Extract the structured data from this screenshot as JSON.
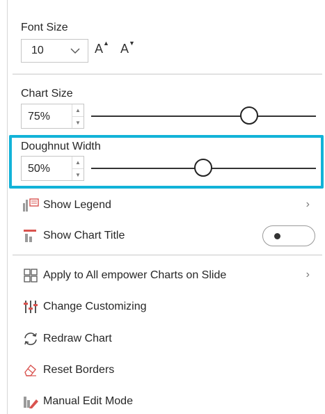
{
  "font_size": {
    "label": "Font Size",
    "value": "10",
    "increase_label": "A",
    "decrease_label": "A"
  },
  "chart_size": {
    "label": "Chart Size",
    "value": "75%",
    "slider_fraction": 0.74
  },
  "doughnut_width": {
    "label": "Doughnut Width",
    "value": "50%",
    "slider_fraction": 0.5
  },
  "menu": {
    "show_legend": "Show Legend",
    "show_chart_title": "Show Chart Title",
    "apply_all": "Apply to All empower Charts on Slide",
    "change_customizing": "Change Customizing",
    "redraw_chart": "Redraw Chart",
    "reset_borders": "Reset Borders",
    "manual_edit_mode": "Manual Edit Mode"
  },
  "colors": {
    "highlight": "#12b3d8",
    "accent_red": "#d9534f"
  }
}
